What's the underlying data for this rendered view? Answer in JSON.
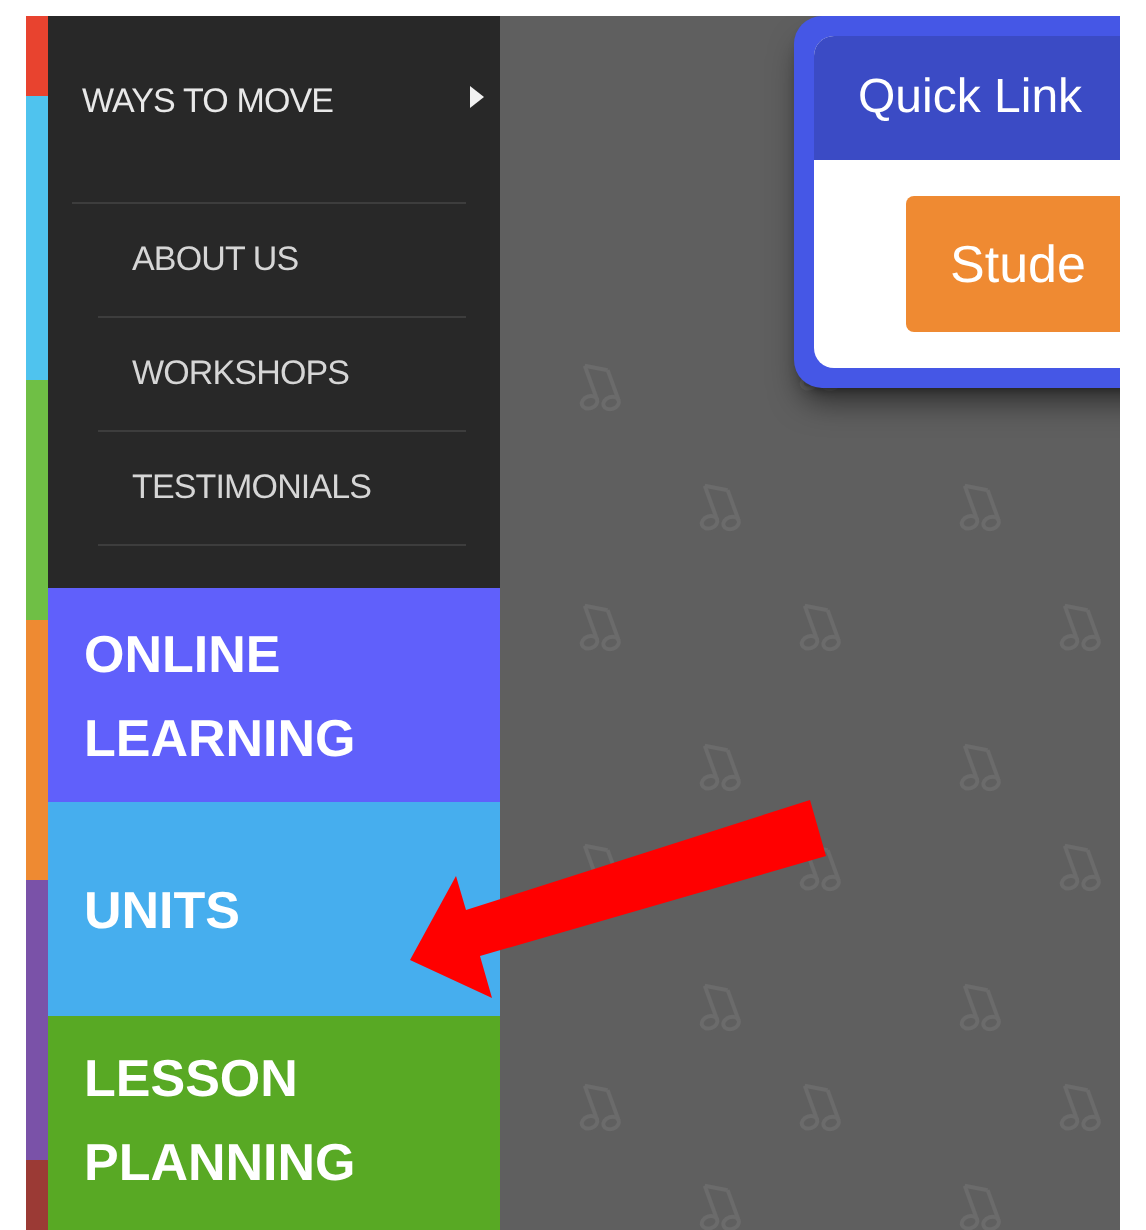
{
  "color_strip": [
    {
      "color": "#e8432f"
    },
    {
      "color": "#4fc3ee"
    },
    {
      "color": "#6fbf45"
    },
    {
      "color": "#ee8a32"
    },
    {
      "color": "#7a52a8"
    },
    {
      "color": "#9b3a35"
    }
  ],
  "menu": {
    "items": [
      {
        "label": "WAYS TO MOVE",
        "kind": "submenu",
        "children": [
          {
            "label": "ABOUT US"
          },
          {
            "label": "WORKSHOPS"
          },
          {
            "label": "TESTIMONIALS"
          }
        ]
      }
    ]
  },
  "nav_sections": [
    {
      "label": "ONLINE LEARNING",
      "color": "#6060fb"
    },
    {
      "label": "UNITS",
      "color": "#46aeee"
    },
    {
      "label": "LESSON PLANNING",
      "color": "#58a924"
    }
  ],
  "quick_links": {
    "title": "Quick Link",
    "buttons": [
      "Stude"
    ]
  },
  "annotations": [
    {
      "kind": "arrow"
    }
  ]
}
